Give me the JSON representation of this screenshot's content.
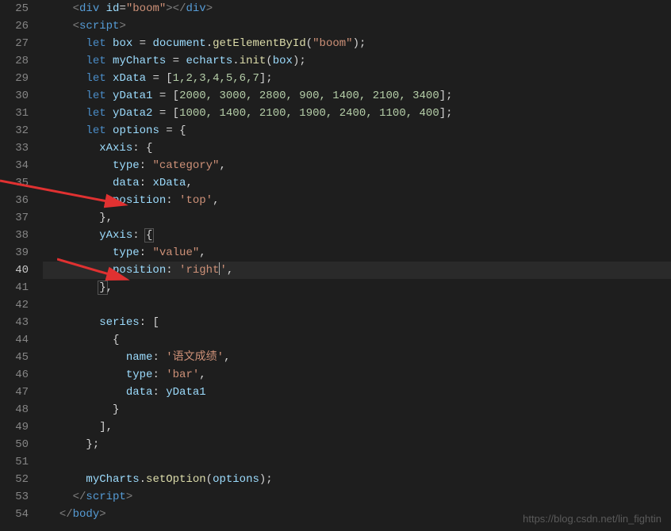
{
  "gutter": {
    "start": 25,
    "end": 54,
    "active": 40
  },
  "code": {
    "l25": {
      "indent": "    ",
      "tag_open": "<",
      "tag": "div",
      "attr": "id",
      "eq": "=",
      "val": "\"boom\"",
      "close1": "></",
      "tag2": "div",
      "close2": ">"
    },
    "l26": {
      "indent": "    ",
      "tag_open": "<",
      "tag": "script",
      "close": ">"
    },
    "l27": {
      "indent": "      ",
      "kw": "let",
      "var": "box",
      "eq": " = ",
      "obj": "document",
      "dot": ".",
      "fn": "getElementById",
      "paren_o": "(",
      "str": "\"boom\"",
      "paren_c": ");"
    },
    "l28": {
      "indent": "      ",
      "kw": "let",
      "var": "myCharts",
      "eq": " = ",
      "obj": "echarts",
      "dot": ".",
      "fn": "init",
      "paren_o": "(",
      "arg": "box",
      "paren_c": ");"
    },
    "l29": {
      "indent": "      ",
      "kw": "let",
      "var": "xData",
      "eq": " = [",
      "nums": "1,2,3,4,5,6,7",
      "close": "];"
    },
    "l30": {
      "indent": "      ",
      "kw": "let",
      "var": "yData1",
      "eq": " = [",
      "nums": "2000, 3000, 2800, 900, 1400, 2100, 3400",
      "close": "];"
    },
    "l31": {
      "indent": "      ",
      "kw": "let",
      "var": "yData2",
      "eq": " = [",
      "nums": "1000, 1400, 2100, 1900, 2400, 1100, 400",
      "close": "];"
    },
    "l32": {
      "indent": "      ",
      "kw": "let",
      "var": "options",
      "eq": " = {"
    },
    "l33": {
      "indent": "        ",
      "prop": "xAxis",
      "rest": ": {"
    },
    "l34": {
      "indent": "          ",
      "prop": "type",
      "colon": ": ",
      "str": "\"category\"",
      "comma": ","
    },
    "l35": {
      "indent": "          ",
      "prop": "data",
      "colon": ": ",
      "var": "xData",
      "comma": ","
    },
    "l36": {
      "indent": "          ",
      "prop": "position",
      "colon": ": ",
      "str": "'top'",
      "comma": ","
    },
    "l37": {
      "indent": "        ",
      "close": "},"
    },
    "l38": {
      "indent": "        ",
      "prop": "yAxis",
      "rest": ": ",
      "brace": "{"
    },
    "l39": {
      "indent": "          ",
      "prop": "type",
      "colon": ": ",
      "str": "\"value\"",
      "comma": ","
    },
    "l40": {
      "indent": "          ",
      "prop": "position",
      "colon": ": ",
      "str_o": "'right",
      "str_c": "'",
      "comma": ","
    },
    "l41": {
      "indent": "        ",
      "close": "}",
      "comma": ","
    },
    "l42": {
      "indent": ""
    },
    "l43": {
      "indent": "        ",
      "prop": "series",
      "rest": ": ["
    },
    "l44": {
      "indent": "          ",
      "brace": "{"
    },
    "l45": {
      "indent": "            ",
      "prop": "name",
      "colon": ": ",
      "str": "'语文成绩'",
      "comma": ","
    },
    "l46": {
      "indent": "            ",
      "prop": "type",
      "colon": ": ",
      "str": "'bar'",
      "comma": ","
    },
    "l47": {
      "indent": "            ",
      "prop": "data",
      "colon": ": ",
      "var": "yData1"
    },
    "l48": {
      "indent": "          ",
      "close": "}"
    },
    "l49": {
      "indent": "        ",
      "close": "],"
    },
    "l50": {
      "indent": "      ",
      "close": "};"
    },
    "l51": {
      "indent": ""
    },
    "l52": {
      "indent": "      ",
      "obj": "myCharts",
      "dot": ".",
      "fn": "setOption",
      "paren_o": "(",
      "arg": "options",
      "paren_c": ");"
    },
    "l53": {
      "indent": "    ",
      "tag_open": "</",
      "tag": "script",
      "close": ">"
    },
    "l54": {
      "indent": "  ",
      "tag_open": "</",
      "tag": "body",
      "close": ">"
    }
  },
  "watermark": "https://blog.csdn.net/lin_fightin"
}
